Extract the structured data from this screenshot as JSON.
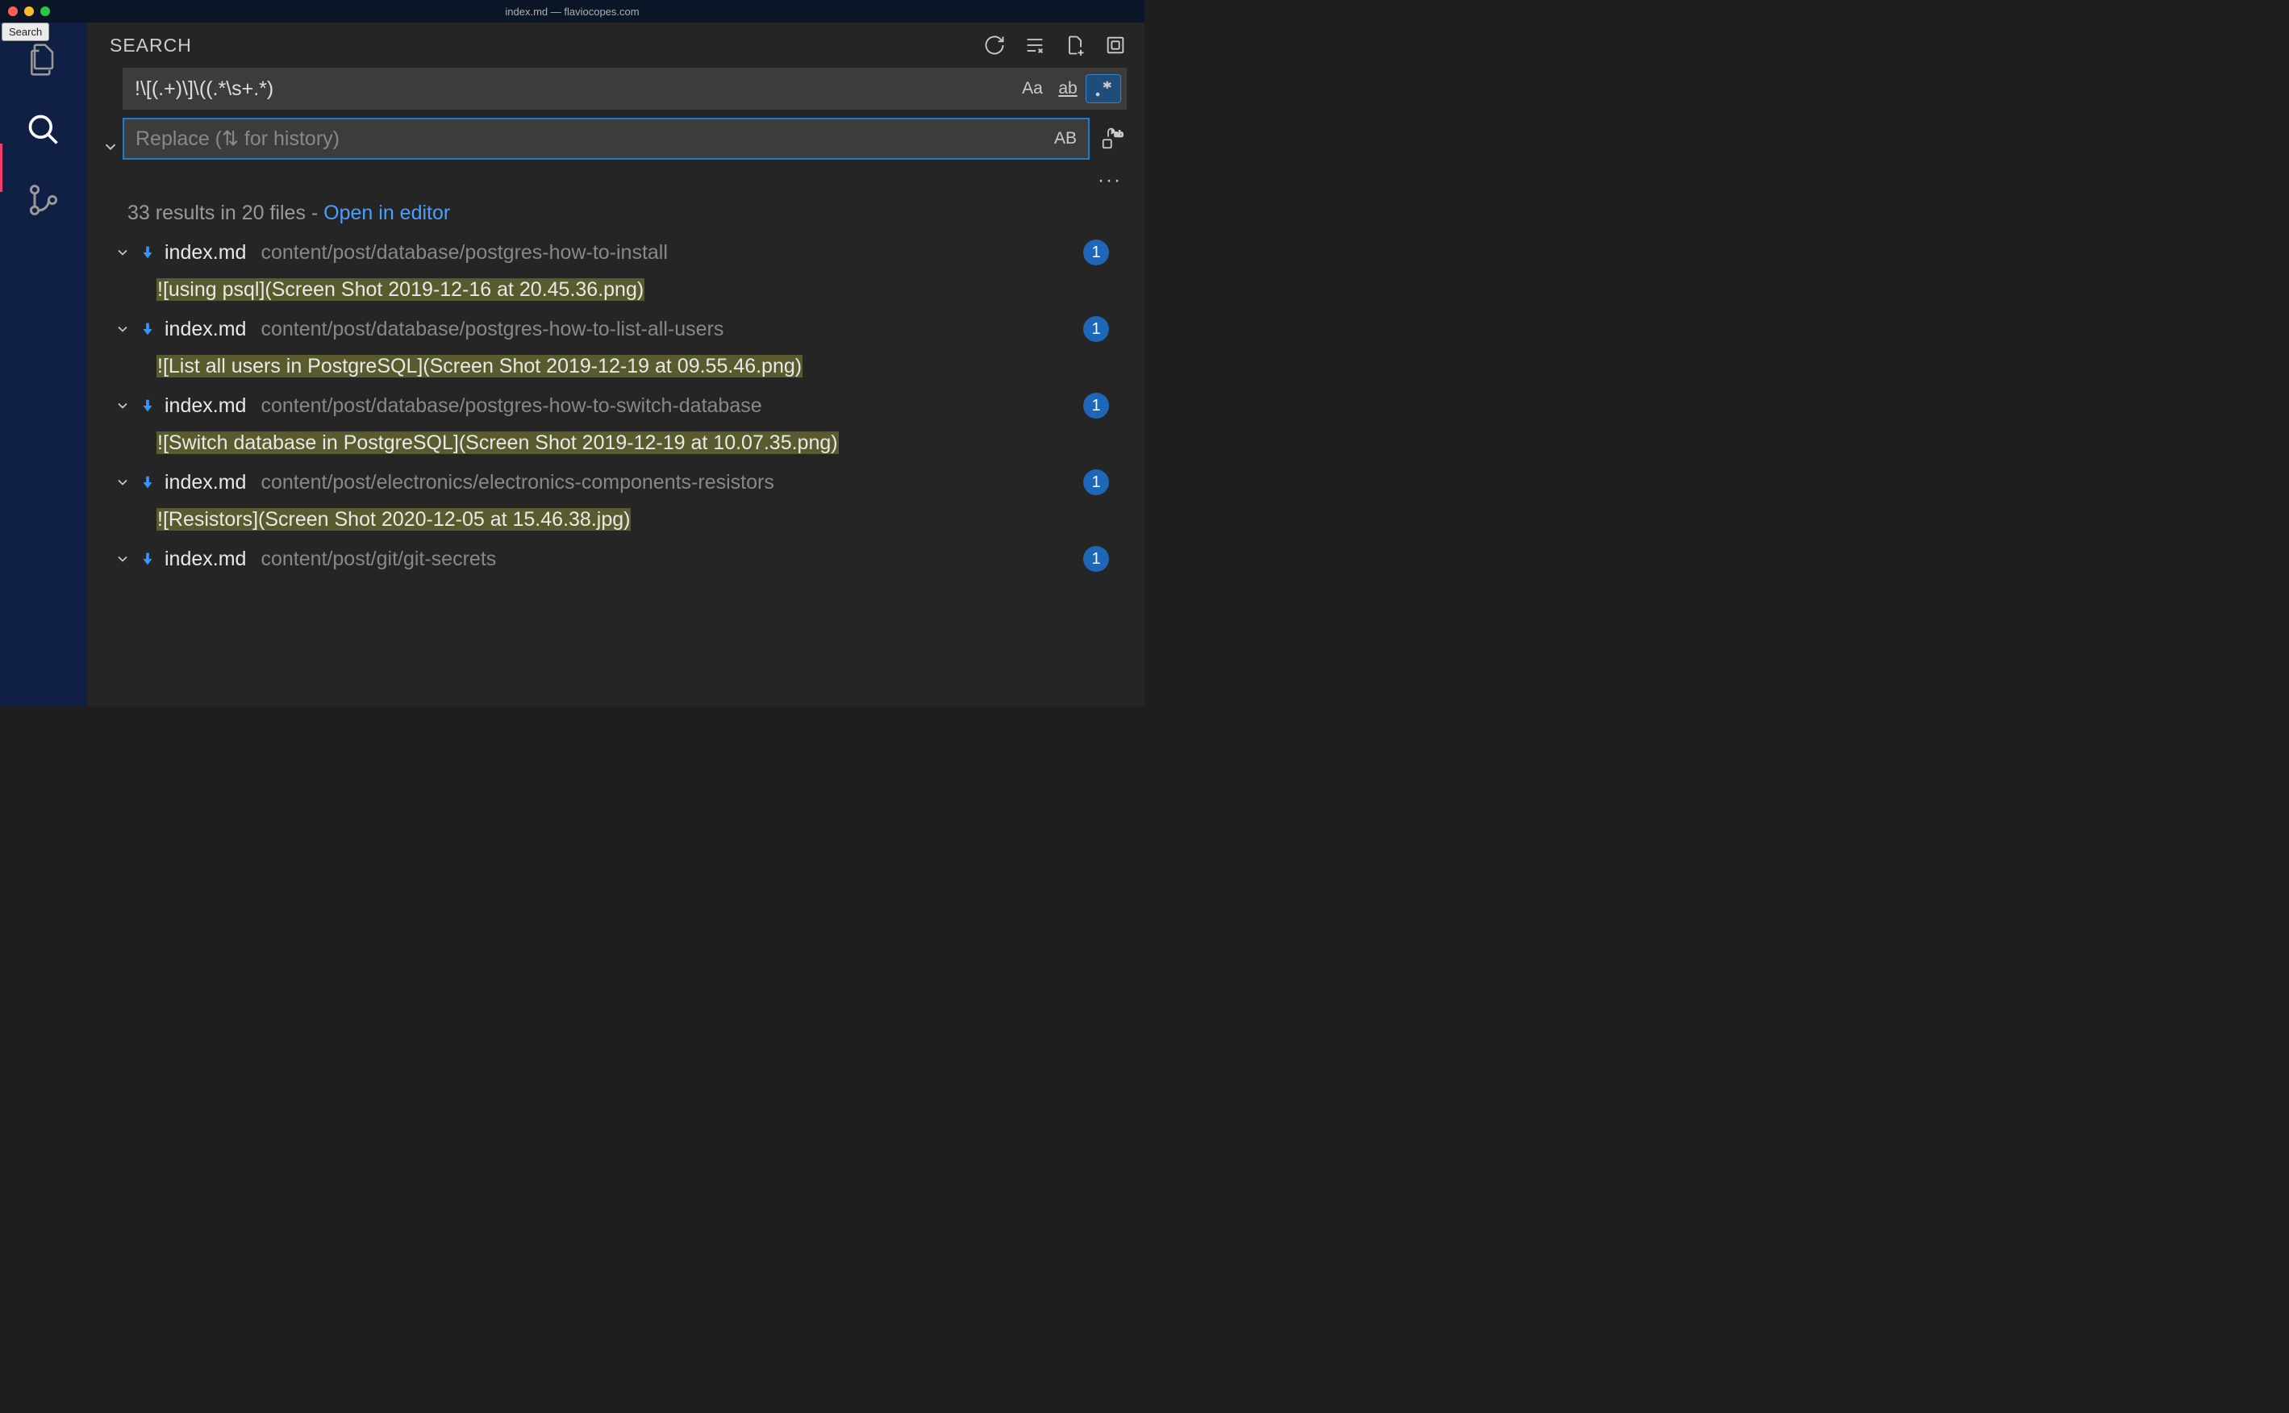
{
  "window": {
    "title": "index.md — flaviocopes.com"
  },
  "tooltip": "Search",
  "panel": {
    "title": "SEARCH"
  },
  "search": {
    "value": "!\\[(.+)\\]\\((.*\\s+.*)",
    "replace_placeholder": "Replace (⇅ for history)",
    "options": {
      "case": "Aa",
      "word": "ab",
      "regex": ".*",
      "preserve": "AB"
    }
  },
  "results": {
    "summary_count": "33 results in 20 files",
    "summary_sep": " - ",
    "open_link": "Open in editor",
    "items": [
      {
        "file": "index.md",
        "path": "content/post/database/postgres-how-to-install",
        "count": "1",
        "match": "![using psql](Screen Shot 2019-12-16 at 20.45.36.png)"
      },
      {
        "file": "index.md",
        "path": "content/post/database/postgres-how-to-list-all-users",
        "count": "1",
        "match": "![List all users in PostgreSQL](Screen Shot 2019-12-19 at 09.55.46.png)"
      },
      {
        "file": "index.md",
        "path": "content/post/database/postgres-how-to-switch-database",
        "count": "1",
        "match": "![Switch database in PostgreSQL](Screen Shot 2019-12-19 at 10.07.35.png)"
      },
      {
        "file": "index.md",
        "path": "content/post/electronics/electronics-components-resistors",
        "count": "1",
        "match": "![Resistors](Screen Shot 2020-12-05 at 15.46.38.jpg)"
      },
      {
        "file": "index.md",
        "path": "content/post/git/git-secrets",
        "count": "1",
        "match": ""
      }
    ]
  }
}
